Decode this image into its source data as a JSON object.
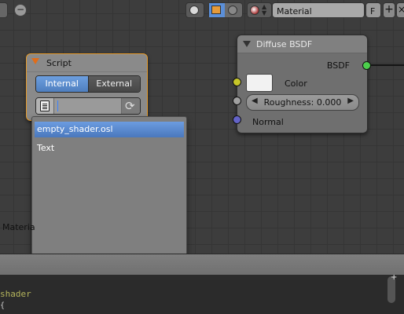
{
  "script_node": {
    "title": "Script",
    "mode_internal": "Internal",
    "mode_external": "External",
    "selected_mode": "Internal",
    "text_value": "",
    "text_icon": "text-datablock-icon",
    "reload_icon": "reload-icon"
  },
  "dropdown": {
    "items": [
      {
        "label": "empty_shader.osl",
        "selected": true
      },
      {
        "label": "Text",
        "selected": false
      }
    ]
  },
  "diffuse_node": {
    "title": "Diffuse BSDF",
    "output_label": "BSDF",
    "color_label": "Color",
    "color_value": "#f2f2f2",
    "roughness_label": "Roughness: 0.000",
    "normal_label": "Normal"
  },
  "canvas": {
    "partial_label": "Materia"
  },
  "header": {
    "material_name": "Material",
    "fake_user": "F",
    "add_symbol": "+",
    "close_symbol": "×",
    "minus_symbol": "−"
  },
  "text_editor": {
    "line1": "shader",
    "line2": "{"
  },
  "colors": {
    "selection_blue": "#5a8ad0",
    "node_border_active": "#e69b2a",
    "socket_shader": "#4ccf4c",
    "socket_color": "#c7c729",
    "socket_value": "#a0a0a0",
    "socket_vector": "#6363c7"
  }
}
